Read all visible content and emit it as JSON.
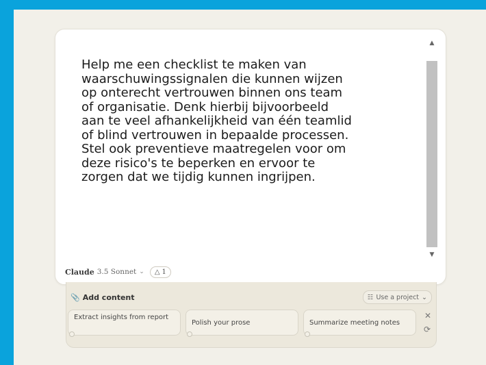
{
  "prompt": {
    "text": "Help me een checklist te maken van\nwaarschuwingssignalen die kunnen wijzen\nop onterecht vertrouwen binnen ons team\nof organisatie. Denk hierbij bijvoorbeeld\naan te veel afhankelijkheid van één teamlid\nof blind vertrouwen in bepaalde processen.\nStel ook preventieve maatregelen voor om\ndeze risico's te beperken en ervoor te\nzorgen dat we tijdig kunnen ingrijpen."
  },
  "model": {
    "name": "Claude",
    "version": "3.5 Sonnet",
    "attachment_count": "1"
  },
  "tray": {
    "add_content": "Add content",
    "use_project": "Use a project"
  },
  "suggestions": [
    "Extract insights from report",
    "Polish your prose",
    "Summarize meeting notes"
  ],
  "colors": {
    "frame": "#0aa3dc",
    "background": "#f2f0e9",
    "tray": "#ece8dc"
  },
  "icons": [
    "chevron-up-icon",
    "chevron-down-icon",
    "person-icon",
    "paperclip-icon",
    "project-icon",
    "close-icon",
    "refresh-icon"
  ]
}
